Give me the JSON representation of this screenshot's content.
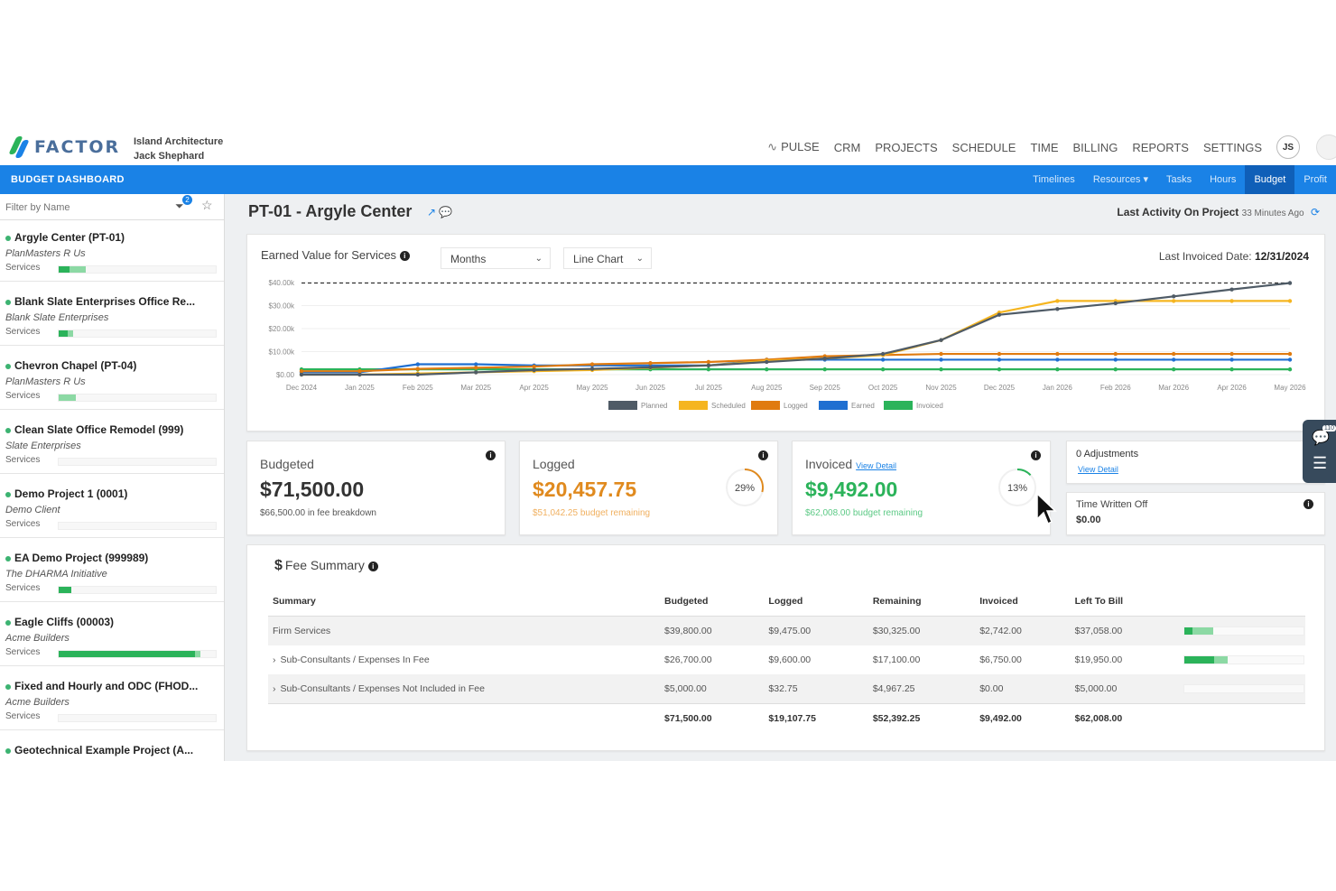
{
  "app": {
    "brand": "FACTOR",
    "brand_colors": [
      "#2bb35a",
      "#1a82e6",
      "#4a6e9b"
    ],
    "org_name": "Island Architecture",
    "user_name": "Jack Shephard",
    "avatar_initials": "JS"
  },
  "topnav": [
    "PULSE",
    "CRM",
    "PROJECTS",
    "SCHEDULE",
    "TIME",
    "BILLING",
    "REPORTS",
    "SETTINGS"
  ],
  "bluebar": {
    "title": "BUDGET DASHBOARD",
    "subnav": [
      "Timelines",
      "Resources ▾",
      "Tasks",
      "Hours",
      "Budget",
      "Profit"
    ],
    "active": "Budget"
  },
  "sidebar": {
    "filter_placeholder": "Filter by Name",
    "filter_badge": "2",
    "services_label": "Services",
    "projects": [
      {
        "name": "Argyle Center (PT-01)",
        "client": "PlanMasters R Us",
        "fill": 0.07,
        "lite": 0.17
      },
      {
        "name": "Blank Slate Enterprises Office Re...",
        "client": "Blank Slate Enterprises",
        "fill": 0.06,
        "lite": 0.09
      },
      {
        "name": "Chevron Chapel (PT-04)",
        "client": "PlanMasters R Us",
        "fill": 0.0,
        "lite": 0.11
      },
      {
        "name": "Clean Slate Office Remodel (999)",
        "client": "Slate Enterprises",
        "fill": 0.0,
        "lite": 0.0
      },
      {
        "name": "Demo Project 1 (0001)",
        "client": "Demo Client",
        "fill": 0.0,
        "lite": 0.0
      },
      {
        "name": "EA Demo Project (999989)",
        "client": "The DHARMA Initiative",
        "fill": 0.08,
        "lite": 0.08
      },
      {
        "name": "Eagle Cliffs (00003)",
        "client": "Acme Builders",
        "fill": 0.87,
        "lite": 0.9
      },
      {
        "name": "Fixed and Hourly and ODC (FHOD...",
        "client": "Acme Builders",
        "fill": 0.0,
        "lite": 0.0
      },
      {
        "name": "Geotechnical Example Project (A...",
        "client": "",
        "fill": 0.0,
        "lite": 0.0
      }
    ]
  },
  "project": {
    "title": "PT-01 - Argyle Center",
    "last_activity_label": "Last Activity On Project",
    "last_activity_time": "33 Minutes Ago"
  },
  "chart_card": {
    "title": "Earned Value for Services",
    "period_select": "Months",
    "chart_select": "Line Chart",
    "last_invoiced_label": "Last Invoiced Date:",
    "last_invoiced_value": "12/31/2024"
  },
  "chart_data": {
    "type": "line",
    "x": [
      "Dec 2024",
      "Jan 2025",
      "Feb 2025",
      "Mar 2025",
      "Apr 2025",
      "May 2025",
      "Jun 2025",
      "Jul 2025",
      "Aug 2025",
      "Sep 2025",
      "Oct 2025",
      "Nov 2025",
      "Dec 2025",
      "Jan 2026",
      "Feb 2026",
      "Mar 2026",
      "Apr 2026",
      "May 2026"
    ],
    "y_ticks": [
      "$0.00",
      "$10.00k",
      "$20.00k",
      "$30.00k",
      "$40.00k"
    ],
    "ylim": [
      0,
      40000
    ],
    "budget_line": 39800,
    "series": [
      {
        "name": "Planned",
        "color": "#4f5b66",
        "values": [
          0,
          0,
          0,
          1000,
          2000,
          2500,
          3200,
          4000,
          5500,
          7000,
          9000,
          15000,
          26000,
          28500,
          31000,
          34000,
          37000,
          39800
        ]
      },
      {
        "name": "Scheduled",
        "color": "#f5b520",
        "values": [
          0,
          0,
          500,
          1000,
          1500,
          2000,
          3000,
          4000,
          6000,
          7000,
          8500,
          15000,
          27000,
          32000,
          32000,
          32000,
          32000,
          32000
        ]
      },
      {
        "name": "Logged",
        "color": "#e07b10",
        "values": [
          1500,
          1500,
          2500,
          3000,
          3500,
          4500,
          5000,
          5500,
          6500,
          8000,
          8500,
          9000,
          9000,
          9000,
          9000,
          9000,
          9000,
          9000
        ]
      },
      {
        "name": "Earned",
        "color": "#1f6fd1",
        "values": [
          1000,
          1000,
          4500,
          4500,
          4000,
          4000,
          4000,
          4000,
          6500,
          6500,
          6500,
          6500,
          6500,
          6500,
          6500,
          6500,
          6500,
          6500
        ]
      },
      {
        "name": "Invoiced",
        "color": "#2bb35a",
        "values": [
          2300,
          2300,
          2300,
          2300,
          2300,
          2300,
          2300,
          2300,
          2300,
          2300,
          2300,
          2300,
          2300,
          2300,
          2300,
          2300,
          2300,
          2300
        ]
      }
    ],
    "legend_position": "bottom"
  },
  "stats": {
    "budgeted": {
      "label": "Budgeted",
      "value": "$71,500.00",
      "sub": "$66,500.00 in fee breakdown"
    },
    "logged": {
      "label": "Logged",
      "value": "$20,457.75",
      "sub": "$51,042.25 budget remaining",
      "percent": "29%",
      "fraction": 0.29,
      "color": "#e08a1e"
    },
    "invoiced": {
      "label": "Invoiced",
      "link": "View Detail",
      "value": "$9,492.00",
      "sub": "$62,008.00 budget remaining",
      "percent": "13%",
      "fraction": 0.13,
      "color": "#2bb35a"
    },
    "adjustments": {
      "label": "0 Adjustments",
      "link": "View Detail"
    },
    "written_off": {
      "label": "Time Written Off",
      "value": "$0.00"
    }
  },
  "fee_summary": {
    "title": "Fee Summary",
    "headers": [
      "Summary",
      "Budgeted",
      "Logged",
      "Remaining",
      "Invoiced",
      "Left To Bill"
    ],
    "rows": [
      {
        "cells": [
          "Firm Services",
          "$39,800.00",
          "$9,475.00",
          "$30,325.00",
          "$2,742.00",
          "$37,058.00"
        ],
        "expand": "",
        "fill": 0.07,
        "lite": 0.24
      },
      {
        "cells": [
          "Sub-Consultants / Expenses In Fee",
          "$26,700.00",
          "$9,600.00",
          "$17,100.00",
          "$6,750.00",
          "$19,950.00"
        ],
        "expand": "›",
        "fill": 0.25,
        "lite": 0.36
      },
      {
        "cells": [
          "Sub-Consultants / Expenses Not Included in Fee",
          "$5,000.00",
          "$32.75",
          "$4,967.25",
          "$0.00",
          "$5,000.00"
        ],
        "expand": "›",
        "fill": 0.0,
        "lite": 0.0
      }
    ],
    "total": [
      "",
      "$71,500.00",
      "$19,107.75",
      "$52,392.25",
      "$9,492.00",
      "$62,008.00"
    ]
  },
  "side_widget": {
    "badge": "110"
  }
}
